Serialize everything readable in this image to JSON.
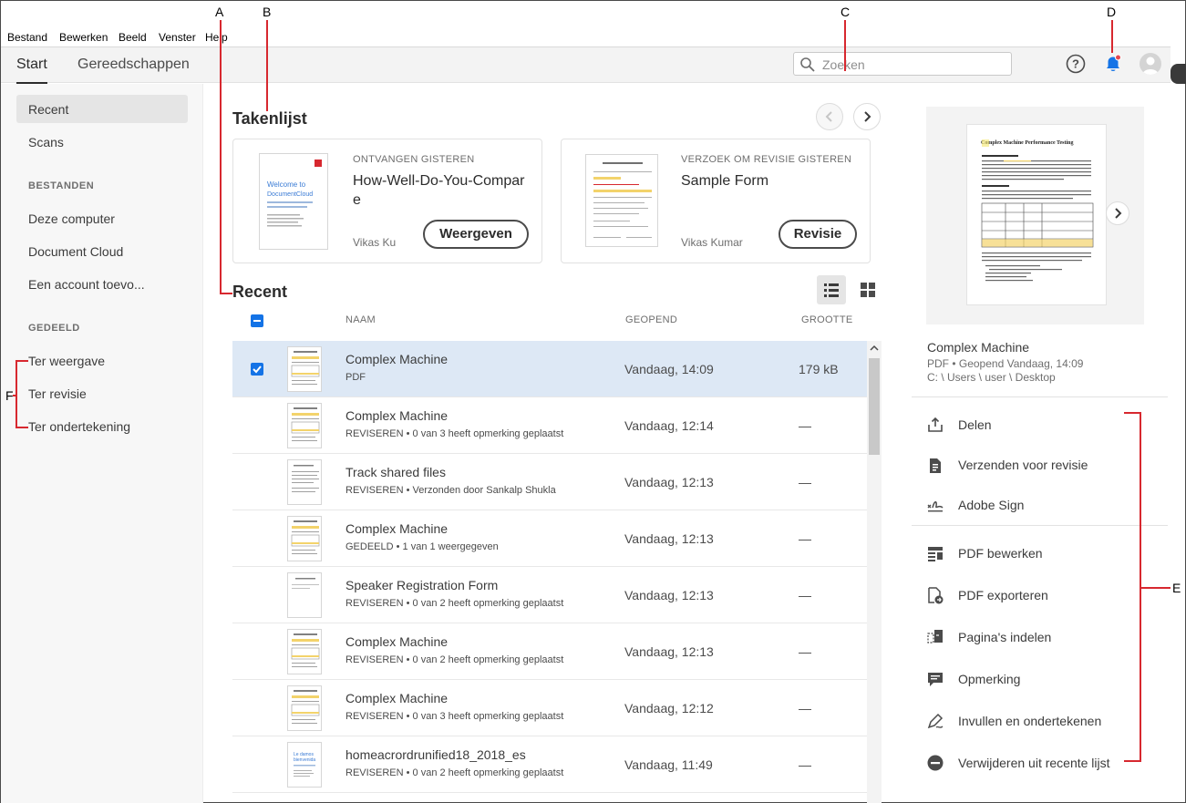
{
  "menu": [
    "Bestand",
    "Bewerken",
    "Beeld",
    "Venster",
    "Help"
  ],
  "tabs": {
    "start": "Start",
    "tools": "Gereedschappen"
  },
  "search": {
    "placeholder": "Zoeken"
  },
  "nav": {
    "recent": "Recent",
    "scans": "Scans",
    "files_head": "BESTANDEN",
    "this_computer": "Deze computer",
    "document_cloud": "Document Cloud",
    "add_account": "Een account toevo...",
    "shared_head": "GEDEELD",
    "for_view": "Ter weergave",
    "for_review": "Ter revisie",
    "for_sign": "Ter ondertekening"
  },
  "tasklist": {
    "title": "Takenlijst",
    "cards": [
      {
        "type": "ONTVANGEN GISTEREN",
        "name": "How-Well-Do-You-Compare",
        "user": "Vikas Ku",
        "button": "Weergeven"
      },
      {
        "type": "VERZOEK OM REVISIE GISTEREN",
        "name": "Sample Form",
        "user": "Vikas Kumar",
        "button": "Revisie"
      }
    ]
  },
  "recent": {
    "title": "Recent",
    "columns": {
      "name": "NAAM",
      "opened": "GEOPEND",
      "size": "GROOTTE"
    },
    "rows": [
      {
        "name": "Complex Machine",
        "sub": "PDF",
        "opened": "Vandaag, 14:09",
        "size": "179 kB"
      },
      {
        "name": "Complex Machine",
        "sub": "REVISEREN  •  0 van 3 heeft opmerking geplaatst",
        "opened": "Vandaag, 12:14",
        "size": "—"
      },
      {
        "name": "Track shared files",
        "sub": "REVISEREN  •  Verzonden door Sankalp Shukla",
        "opened": "Vandaag, 12:13",
        "size": "—"
      },
      {
        "name": "Complex Machine",
        "sub": "GEDEELD  •  1 van 1 weergegeven",
        "opened": "Vandaag, 12:13",
        "size": "—"
      },
      {
        "name": "Speaker Registration Form",
        "sub": "REVISEREN  •  0 van 2 heeft opmerking geplaatst",
        "opened": "Vandaag, 12:13",
        "size": "—"
      },
      {
        "name": "Complex Machine",
        "sub": "REVISEREN  •  0 van 2 heeft opmerking geplaatst",
        "opened": "Vandaag, 12:13",
        "size": "—"
      },
      {
        "name": "Complex Machine",
        "sub": "REVISEREN  •  0 van 3 heeft opmerking geplaatst",
        "opened": "Vandaag, 12:12",
        "size": "—"
      },
      {
        "name": "homeacrordrunified18_2018_es",
        "sub": "REVISEREN  •  0 van 2 heeft opmerking geplaatst",
        "opened": "Vandaag, 11:49",
        "size": "—"
      }
    ]
  },
  "preview": {
    "doc_title": "Complex Machine Performance Testing",
    "name": "Complex Machine",
    "meta": "PDF  •  Geopend Vandaag, 14:09",
    "path": "C: \\ Users \\ user \\ Desktop"
  },
  "actions": [
    "Delen",
    "Verzenden voor revisie",
    "Adobe Sign",
    "PDF bewerken",
    "PDF exporteren",
    "Pagina's indelen",
    "Opmerking",
    "Invullen en ondertekenen",
    "Verwijderen uit recente lijst"
  ],
  "annotations": {
    "A": "A",
    "B": "B",
    "C": "C",
    "D": "D",
    "E": "E",
    "F": "F"
  },
  "colors": {
    "accent": "#1473e6",
    "annotation": "#d7282f",
    "selection": "#dde8f5",
    "notification": "#e34850"
  }
}
